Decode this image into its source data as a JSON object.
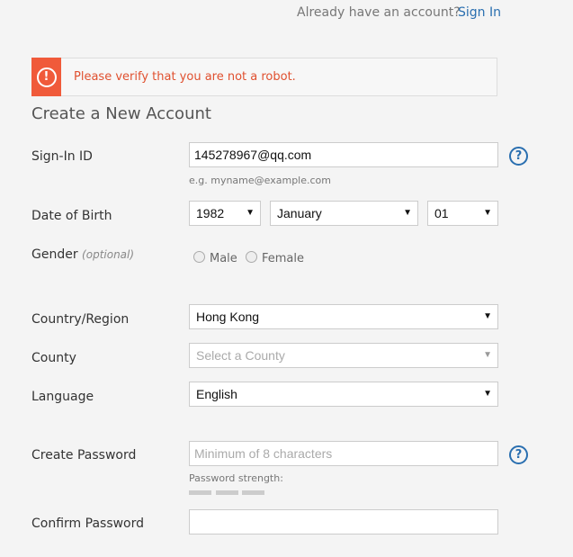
{
  "header": {
    "already_text": "Already have an account?",
    "signin_label": "Sign In"
  },
  "alert": {
    "icon": "exclamation-circle-icon",
    "message": "Please verify that you are not a robot."
  },
  "form": {
    "title": "Create a New Account",
    "signin_id": {
      "label": "Sign-In ID",
      "value": "145278967@qq.com",
      "hint": "e.g. myname@example.com"
    },
    "dob": {
      "label": "Date of Birth",
      "year": "1982",
      "month": "January",
      "day": "01"
    },
    "gender": {
      "label": "Gender",
      "optional": "(optional)",
      "options": [
        "Male",
        "Female"
      ]
    },
    "country": {
      "label": "Country/Region",
      "value": "Hong Kong"
    },
    "county": {
      "label": "County",
      "placeholder": "Select a County"
    },
    "language": {
      "label": "Language",
      "value": "English"
    },
    "password": {
      "label": "Create Password",
      "placeholder": "Minimum of 8 characters",
      "strength_label": "Password strength:"
    },
    "confirm": {
      "label": "Confirm Password",
      "value": ""
    }
  },
  "colors": {
    "accent": "#2a6fb0",
    "error": "#e0502f",
    "error_icon_bg": "#f05a3a"
  }
}
